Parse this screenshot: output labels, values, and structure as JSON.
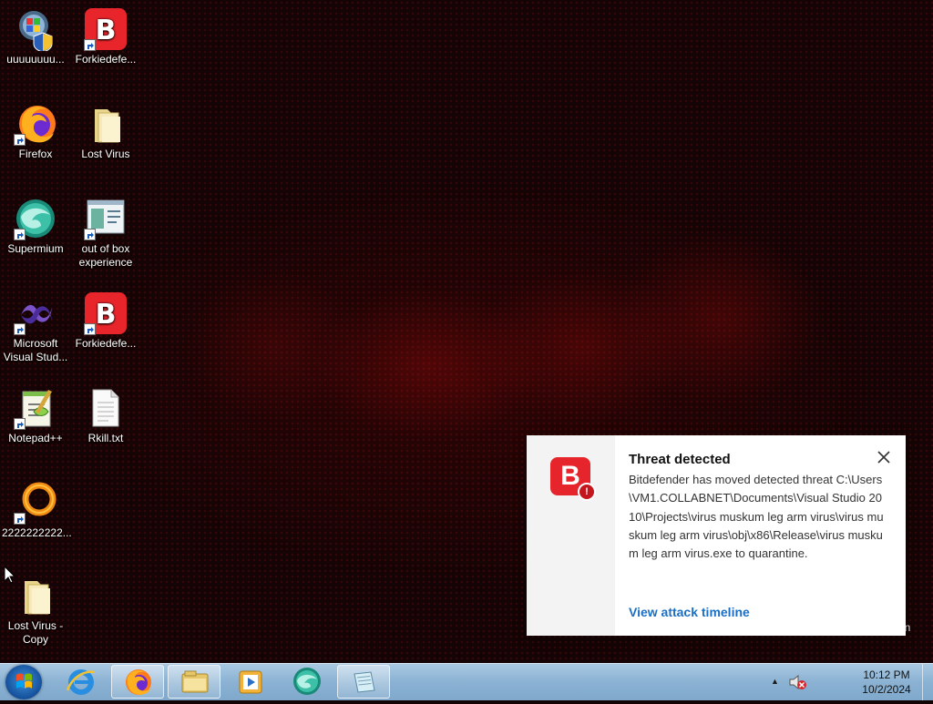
{
  "desktop_icons": [
    {
      "label": "uuuuuuuu...",
      "icon": "windows-update-icon"
    },
    {
      "label": "Forkiedefe...",
      "icon": "bitdefender-icon"
    },
    {
      "label": "Firefox",
      "icon": "firefox-icon"
    },
    {
      "label": "Lost Virus",
      "icon": "folder-icon"
    },
    {
      "label": "Supermium",
      "icon": "supermium-icon"
    },
    {
      "label": "out of box experience",
      "icon": "window-app-icon"
    },
    {
      "label": "Microsoft Visual Stud...",
      "icon": "visual-studio-icon"
    },
    {
      "label": "Forkiedefe...",
      "icon": "bitdefender-icon"
    },
    {
      "label": "Notepad++",
      "icon": "notepad-plus-plus-icon"
    },
    {
      "label": "Rkill.txt",
      "icon": "text-file-icon"
    },
    {
      "label": "2222222222...",
      "icon": "orange-ring-icon"
    },
    {
      "label": "Lost Virus - Copy",
      "icon": "folder-icon"
    }
  ],
  "notification": {
    "logo_letter": "B",
    "badge": "!",
    "title": "Threat detected",
    "message": "Bitdefender has moved detected threat C:\\Users\\VM1.COLLABNET\\Documents\\Visual Studio 2010\\Projects\\virus muskum leg arm virus\\virus muskum leg arm virus\\obj\\x86\\Release\\virus muskum leg arm virus.exe to quarantine.",
    "link": "View attack timeline"
  },
  "partial_label": "in",
  "taskbar": {
    "pinned": [
      "internet-explorer-icon",
      "firefox-icon",
      "file-explorer-icon",
      "media-player-icon",
      "supermium-icon",
      "notepad-icon"
    ],
    "tray_arrow": "▲",
    "clock_time": "10:12 PM",
    "clock_date": "10/2/2024"
  },
  "colors": {
    "bitdefender_red": "#e5252b",
    "link_blue": "#1a6fc4"
  }
}
